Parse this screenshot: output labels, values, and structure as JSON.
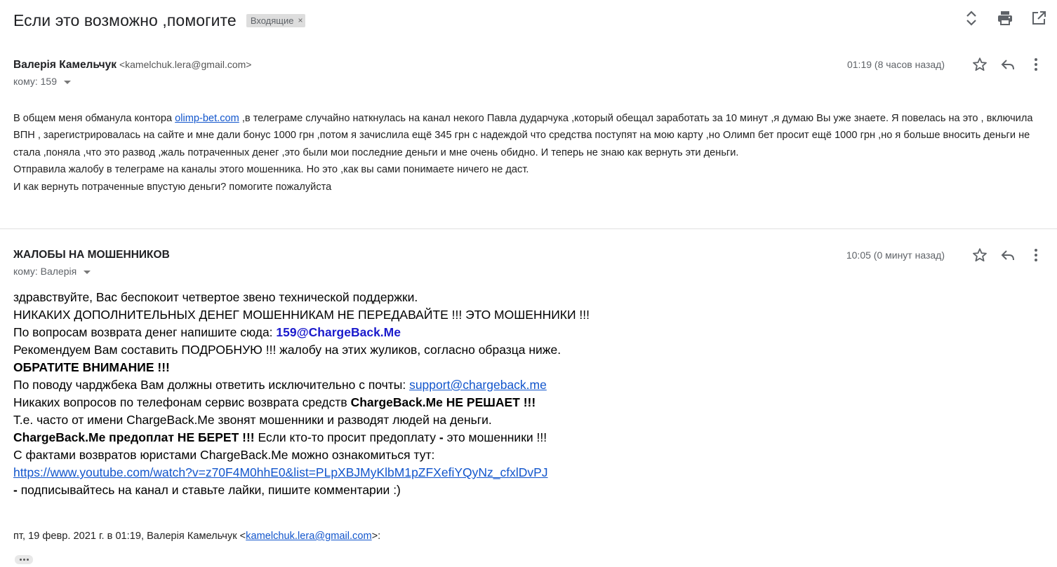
{
  "thread": {
    "subject": "Если это возможно ,помогите",
    "label": "Входящие",
    "label_close": "×"
  },
  "icons": {
    "expand": "unfold-icon",
    "print": "print-icon",
    "open_new": "open-in-new-icon",
    "star": "star-icon",
    "reply": "reply-icon",
    "more": "more-vert-icon"
  },
  "message1": {
    "sender_name": "Валерія Камельчук",
    "sender_email": "<kamelchuk.lera@gmail.com>",
    "to": "кому: 159",
    "time": "01:19 (8 часов назад)",
    "p1_a": "В общем меня обманула контора ",
    "p1_link": "olimp-bet.com",
    "p1_b": " ,в телеграме случайно наткнулась на канал некого Павла дударчука ,который обещал заработать за 10 минут ,я думаю Вы уже знаете. Я повелась на это , включила ВПН , зарегистрировалась на сайте и мне дали бонус 1000 грн ,потом я зачислила ещё 345 грн с надеждой что средства поступят на мою карту ,но Олимп бет просит ещё 1000 грн ,но я больше вносить деньги не стала ,поняла ,что это развод ,жаль потраченных денег ,это были мои последние деньги и мне очень обидно. И теперь не знаю как вернуть эти деньги.",
    "p2": "Отправила жалобу в телеграме на каналы этого мошенника. Но это ,как вы сами понимаете ничего не даст.",
    "p3": "И как вернуть потраченные впустую деньги? помогите пожалуйста"
  },
  "message2": {
    "sender_name": "ЖАЛОБЫ НА МОШЕННИКОВ",
    "to": "кому: Валерія",
    "time": "10:05 (0 минут назад)",
    "l1": "здравствуйте, Вас беспокоит четвертое звено технической поддержки.",
    "l2": "НИКАКИХ ДОПОЛНИТЕЛЬНЫХ ДЕНЕГ МОШЕННИКАМ НЕ ПЕРЕДАВАЙТЕ !!! ЭТО МОШЕННИКИ !!!",
    "l3_a": "По вопросам возврата денег напишите сюда: ",
    "l3_email": "159@ChargeBack.Me",
    "l4": "Рекомендуем Вам составить ПОДРОБНУЮ !!! жалобу на этих жуликов, согласно образца ниже.",
    "l5": "ОБРАТИТЕ ВНИМАНИЕ !!!",
    "l6_a": "По поводу чарджбека Вам должны ответить исключительно с почты: ",
    "l6_link": "support@chargeback.me",
    "l7_a": "Никаких вопросов по телефонам сервис возврата средств ",
    "l7_b": "ChargeBack.Me НЕ РЕШАЕТ !!!",
    "l8": "Т.е. часто от имени ChargeBack.Me звонят мошенники и разводят людей на деньги.",
    "l9_a": "ChargeBack.Me предоплат НЕ БЕРЕТ !!!",
    "l9_b": " Если кто-то просит предоплату ",
    "l9_c": "-",
    "l9_d": " это мошенники !!!",
    "l10": "С фактами возвратов юристами ChargeBack.Me можно ознакомиться тут:",
    "l11_link": "https://www.youtube.com/watch?v=z70F4M0hhE0&list=PLpXBJMyKlbM1pZFXefiYQyNz_cfxlDvPJ",
    "l12_a": " -",
    "l12_b": " подписывайтесь на канал и ставьте лайки, пишите комментарии :)",
    "quote_a": "пт, 19 февр. 2021 г. в 01:19, Валерія Камельчук <",
    "quote_link": "kamelchuk.lera@gmail.com",
    "quote_b": ">:"
  }
}
